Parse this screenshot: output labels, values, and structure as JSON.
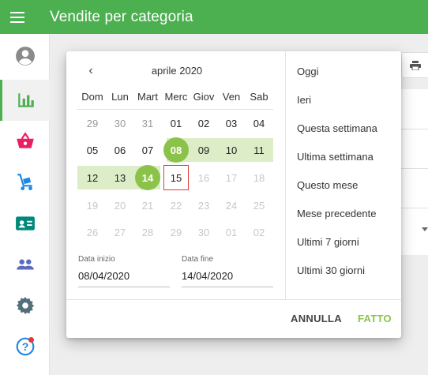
{
  "header": {
    "title": "Vendite per categoria"
  },
  "sidebar": {
    "items": [
      {
        "icon": "account-circle-icon",
        "color": "#757575"
      },
      {
        "icon": "bar-chart-icon",
        "color": "#4caf50"
      },
      {
        "icon": "basket-icon",
        "color": "#e91e63"
      },
      {
        "icon": "hand-truck-icon",
        "color": "#1e88e5"
      },
      {
        "icon": "contact-card-icon",
        "color": "#00897b"
      },
      {
        "icon": "people-icon",
        "color": "#5c6bc0"
      },
      {
        "icon": "gear-icon",
        "color": "#546e7a"
      },
      {
        "icon": "help-icon",
        "color": "#1e88e5"
      }
    ]
  },
  "calendar": {
    "month_label": "aprile 2020",
    "weekdays": [
      "Dom",
      "Lun",
      "Mart",
      "Merc",
      "Giov",
      "Ven",
      "Sab"
    ],
    "weeks": [
      [
        "29",
        "30",
        "31",
        "01",
        "02",
        "03",
        "04"
      ],
      [
        "05",
        "06",
        "07",
        "08",
        "09",
        "10",
        "11"
      ],
      [
        "12",
        "13",
        "14",
        "15",
        "16",
        "17",
        "18"
      ],
      [
        "19",
        "20",
        "21",
        "22",
        "23",
        "24",
        "25"
      ],
      [
        "26",
        "27",
        "28",
        "29",
        "30",
        "01",
        "02"
      ]
    ],
    "start_field": {
      "label": "Data inizio",
      "value": "08/04/2020"
    },
    "end_field": {
      "label": "Data fine",
      "value": "14/04/2020"
    }
  },
  "presets": [
    "Oggi",
    "Ieri",
    "Questa settimana",
    "Ultima settimana",
    "Questo mese",
    "Mese precedente",
    "Ultimi 7 giorni",
    "Ultimi 30 giorni"
  ],
  "actions": {
    "cancel": "ANNULLA",
    "done": "FATTO"
  },
  "colors": {
    "header": "#4caf50",
    "accent": "#8bc34a",
    "range": "#dcedc8",
    "today_border": "#e53935"
  }
}
